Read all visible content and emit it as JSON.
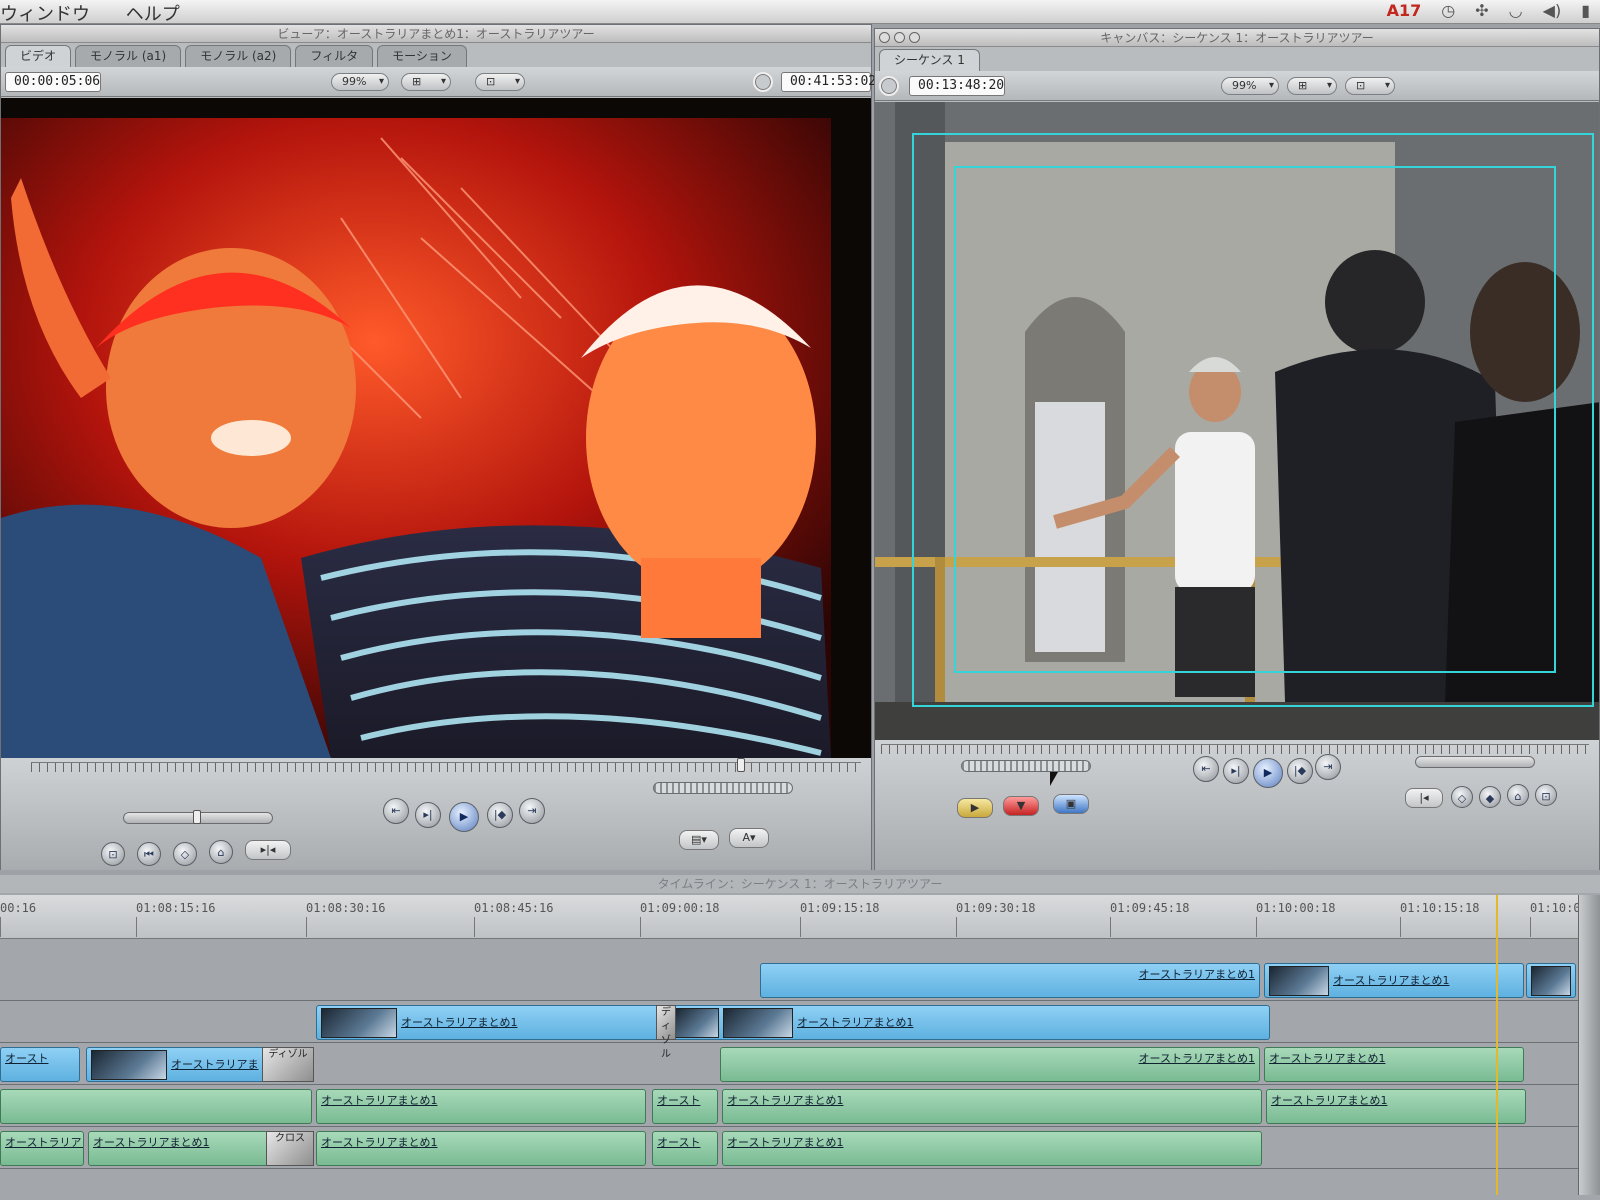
{
  "menubar": {
    "items": [
      "ウィンドウ",
      "ヘルプ"
    ],
    "tray_adobe": "17"
  },
  "viewer": {
    "title": "ビューア：オーストラリアまとめ1：オーストラリアツアー",
    "tabs": [
      "モノラル (a1)",
      "モノラル (a2)",
      "フィルタ",
      "モーション"
    ],
    "timecode_in": "00:00:05:06",
    "zoom": "99%",
    "timecode_duration": "00:41:53:02"
  },
  "canvas": {
    "title": "キャンバス：シーケンス 1：オーストラリアツアー",
    "tab": "シーケンス 1",
    "timecode": "00:13:48:20",
    "zoom": "99%"
  },
  "timeline": {
    "title": "タイムライン：シーケンス 1：オーストラリアツアー",
    "ruler": [
      "00:16",
      "01:08:15:16",
      "01:08:30:16",
      "01:08:45:16",
      "01:09:00:18",
      "01:09:15:18",
      "01:09:30:18",
      "01:09:45:18",
      "01:10:00:18",
      "01:10:15:18",
      "01:10:0"
    ],
    "clip_name": "オーストラリアまとめ1",
    "clip_name_short": "オースト",
    "clip_name_trunc": "オーストラリアま",
    "trans_label": "ディゾル",
    "trans_label2": "クロス"
  },
  "colors": {
    "video_clip": "#6cc0ec",
    "audio_clip": "#8fcaa5",
    "title_safe": "#34d4d8",
    "playhead": "#e3b82c"
  }
}
